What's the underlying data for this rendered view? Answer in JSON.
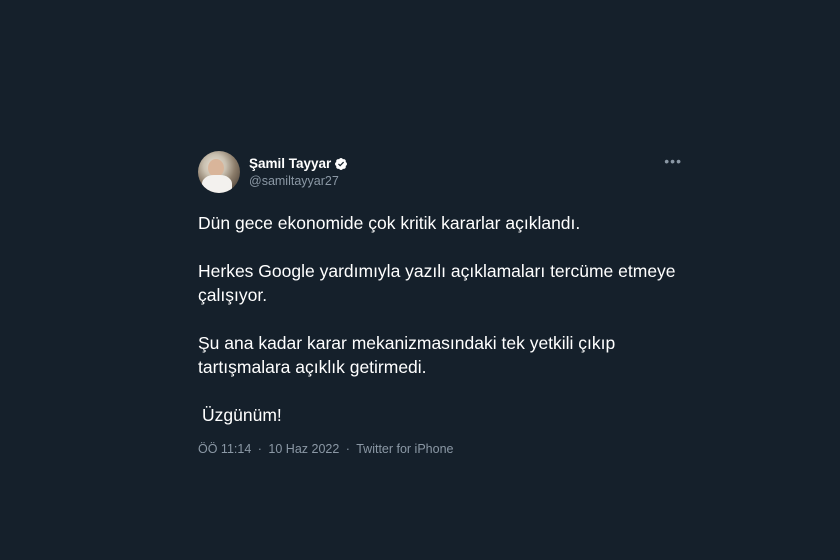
{
  "tweet": {
    "author": {
      "display_name": "Şamil Tayyar",
      "handle": "@samiltayyar27",
      "verified": true,
      "avatar_icon": "profile-photo"
    },
    "more_icon": "more-horizontal-icon",
    "more_label": "•••",
    "paragraphs": [
      "Dün gece ekonomide çok kritik kararlar açıklandı.",
      "Herkes Google yardımıyla yazılı açıklamaları tercüme etmeye çalışıyor.",
      "Şu ana kadar karar mekanizmasındaki tek yetkili çıkıp tartışmalara açıklık getirmedi.",
      "Üzgünüm!"
    ],
    "meta": {
      "time": "ÖÖ 11:14",
      "separator": "·",
      "date": "10 Haz 2022",
      "source": "Twitter for iPhone"
    }
  },
  "colors": {
    "background": "#15202b",
    "text": "#ffffff",
    "secondary_text": "#8b98a5",
    "verified_badge": "#ffffff"
  }
}
